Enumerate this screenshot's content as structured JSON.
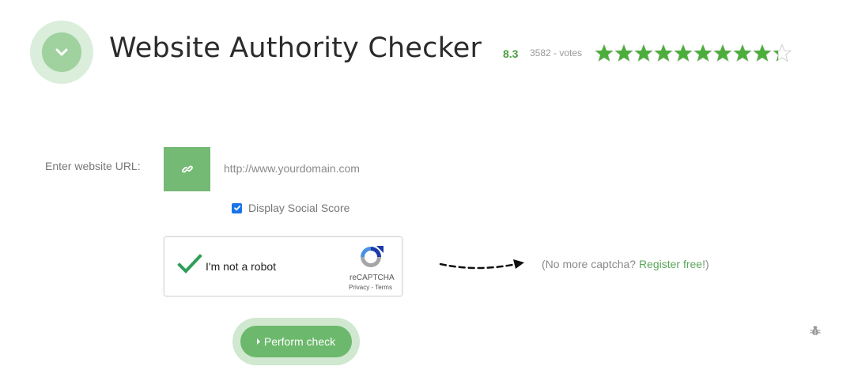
{
  "header": {
    "title": "Website Authority Checker",
    "rating": {
      "score": "8.3",
      "votes": "3582 - votes",
      "stars_value": 9.3,
      "stars_max": 10
    }
  },
  "form": {
    "url_label": "Enter website URL:",
    "url_input": {
      "value": "",
      "placeholder": "http://www.yourdomain.com"
    },
    "social_score": {
      "label": "Display Social Score",
      "checked": true
    }
  },
  "captcha": {
    "label": "I'm not a robot",
    "brand": "reCAPTCHA",
    "links": "Privacy - Terms"
  },
  "register": {
    "prefix": "(No more captcha? ",
    "link": "Register free!",
    "suffix": ")"
  },
  "submit": {
    "label": "Perform check"
  },
  "colors": {
    "accent_green": "#74b974",
    "star_green": "#4cae3a",
    "link_green": "#5aa65a"
  },
  "icons": {
    "logo": "chevron-down-icon",
    "link_button": "link-icon",
    "captcha_check": "checkmark-icon",
    "arrow": "dashed-arrow-icon",
    "bug": "bug-icon"
  }
}
